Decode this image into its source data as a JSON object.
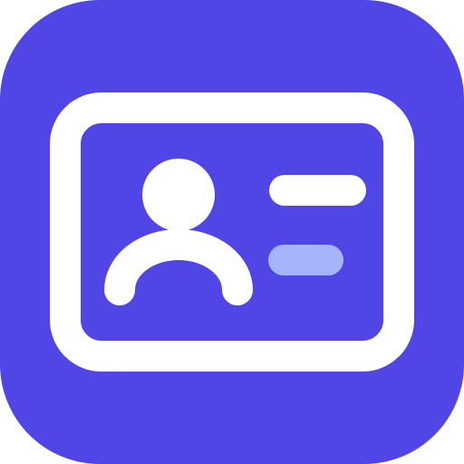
{
  "icon": {
    "name": "contact-card-icon",
    "colors": {
      "background": "#4F46E5",
      "foreground": "#FFFFFF",
      "accent_line": "#A5B4FC"
    }
  }
}
